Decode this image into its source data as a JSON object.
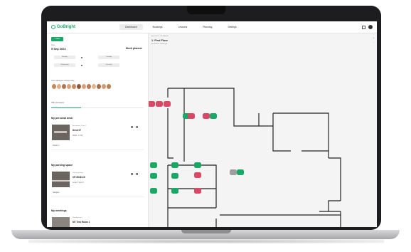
{
  "topbar": {
    "logo": "GoBright",
    "tabs": [
      {
        "label": "Dashboard",
        "active": true
      },
      {
        "label": "Bookings",
        "active": false
      },
      {
        "label": "Lessons",
        "active": false
      },
      {
        "label": "Planning",
        "active": false
      },
      {
        "label": "Settings",
        "active": false
      }
    ]
  },
  "sidebar": {
    "new_button": "+ New",
    "date_label": "Date",
    "date_value": "5 Sep 2022",
    "week_planner": "Week planner",
    "chips": [
      "Monday",
      "Tuesday",
      "Wednesday",
      "Thursday"
    ],
    "colleagues_label": "Your colleagues working today",
    "office_label": "Office occupancy",
    "office_progress": 0.32,
    "personal_desk": {
      "title": "My personal desk",
      "subtitle": "Amsterdam, Floor 1",
      "name": "Desk 07",
      "meta": "09:00 - 17:00",
      "link": "Check in"
    },
    "parking": {
      "title": "My parking space",
      "subtitle": "Parking garage",
      "name": "CP-5048-XX",
      "meta": "Level 1, spot 4",
      "link": "Navigate"
    },
    "meetings": {
      "title": "My meetings",
      "subtitle": "Meeting room",
      "name": "MT Test Room 1"
    }
  },
  "main": {
    "breadcrumb": "Amsterdam > Building A",
    "floor_title": "1. First Floor",
    "floor_subtitle": "Amsterdam, Building A",
    "zoom_in": "+",
    "zoom_out": "-"
  },
  "colors": {
    "brand": "#1aa866",
    "available": "#1aa866",
    "occupied": "#d94864",
    "unavailable": "#9e9e9e"
  }
}
